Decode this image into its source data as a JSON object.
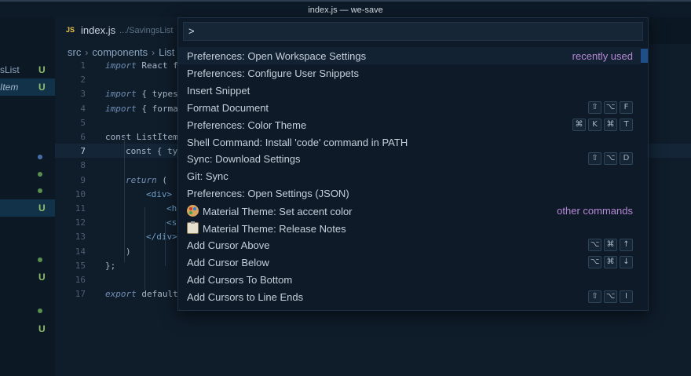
{
  "window": {
    "title": "index.js — we-save"
  },
  "sidebar": {
    "rows": [
      {
        "name": "sList",
        "status": "U"
      },
      {
        "name": "Item",
        "status": "U"
      },
      {
        "status": "U"
      },
      {
        "status": "U"
      },
      {
        "status": "U"
      }
    ]
  },
  "editor": {
    "tab": {
      "badge": "JS",
      "filename": "index.js",
      "path": ".../SavingsList"
    },
    "breadcrumb": [
      "src",
      "components",
      "List"
    ],
    "current_line": 7,
    "lines": [
      {
        "n": "1",
        "code": "import React f"
      },
      {
        "n": "2",
        "code": ""
      },
      {
        "n": "3",
        "code": "import { types"
      },
      {
        "n": "4",
        "code": "import { forma"
      },
      {
        "n": "5",
        "code": ""
      },
      {
        "n": "6",
        "code": "const ListItem"
      },
      {
        "n": "7",
        "code": "const { ty"
      },
      {
        "n": "8",
        "code": ""
      },
      {
        "n": "9",
        "code": "return ("
      },
      {
        "n": "10",
        "code": "<div>"
      },
      {
        "n": "11",
        "code": "<h"
      },
      {
        "n": "12",
        "code": "<s"
      },
      {
        "n": "13",
        "code": "</div>"
      },
      {
        "n": "14",
        "code": ")"
      },
      {
        "n": "15",
        "code": "};"
      },
      {
        "n": "16",
        "code": ""
      },
      {
        "n": "17",
        "code": "export default"
      }
    ]
  },
  "palette": {
    "input_value": ">",
    "items": [
      {
        "label": "Preferences: Open Workspace Settings",
        "tag": "recently used",
        "keys": []
      },
      {
        "label": "Preferences: Configure User Snippets",
        "keys": []
      },
      {
        "label": "Insert Snippet",
        "keys": []
      },
      {
        "label": "Format Document",
        "keys": [
          "⇧",
          "⌥",
          "F"
        ]
      },
      {
        "label": "Preferences: Color Theme",
        "keys": [
          "⌘",
          "K",
          "⌘",
          "T"
        ]
      },
      {
        "label": "Shell Command: Install 'code' command in PATH",
        "keys": []
      },
      {
        "label": "Sync: Download Settings",
        "keys": [
          "⇧",
          "⌥",
          "D"
        ]
      },
      {
        "label": "Git: Sync",
        "keys": []
      },
      {
        "label": "Preferences: Open Settings (JSON)",
        "keys": []
      },
      {
        "label": "Material Theme: Set accent color",
        "tag": "other commands",
        "icon": "artist-palette-icon",
        "keys": []
      },
      {
        "label": "Material Theme: Release Notes",
        "icon": "clipboard-icon",
        "keys": []
      },
      {
        "label": "Add Cursor Above",
        "keys": [
          "⌥",
          "⌘",
          "↑"
        ]
      },
      {
        "label": "Add Cursor Below",
        "keys": [
          "⌥",
          "⌘",
          "↓"
        ]
      },
      {
        "label": "Add Cursors To Bottom",
        "keys": []
      },
      {
        "label": "Add Cursors to Line Ends",
        "keys": [
          "⇧",
          "⌥",
          "I"
        ]
      }
    ]
  },
  "colors": {
    "accent_tag": "#b68ad6",
    "git_untracked": "#8fc26b",
    "selection": "#1f4f88"
  }
}
